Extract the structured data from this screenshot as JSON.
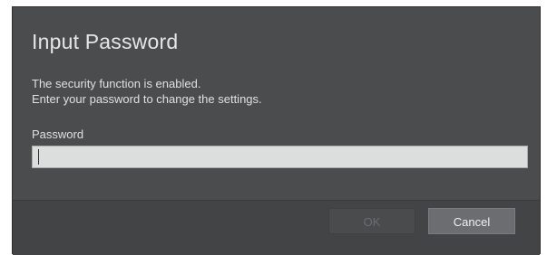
{
  "dialog": {
    "title": "Input Password",
    "message_line1": "The security function is enabled.",
    "message_line2": "Enter your password to change the settings.",
    "password_label": "Password",
    "password_value": "",
    "ok_label": "OK",
    "cancel_label": "Cancel",
    "ok_enabled": false
  },
  "colors": {
    "dialog_background": "#4b4c4e",
    "footer_background": "#434446",
    "input_background": "#dcdddd",
    "input_focus_border": "#8fb2d6",
    "cancel_button": "#6b6d70"
  }
}
